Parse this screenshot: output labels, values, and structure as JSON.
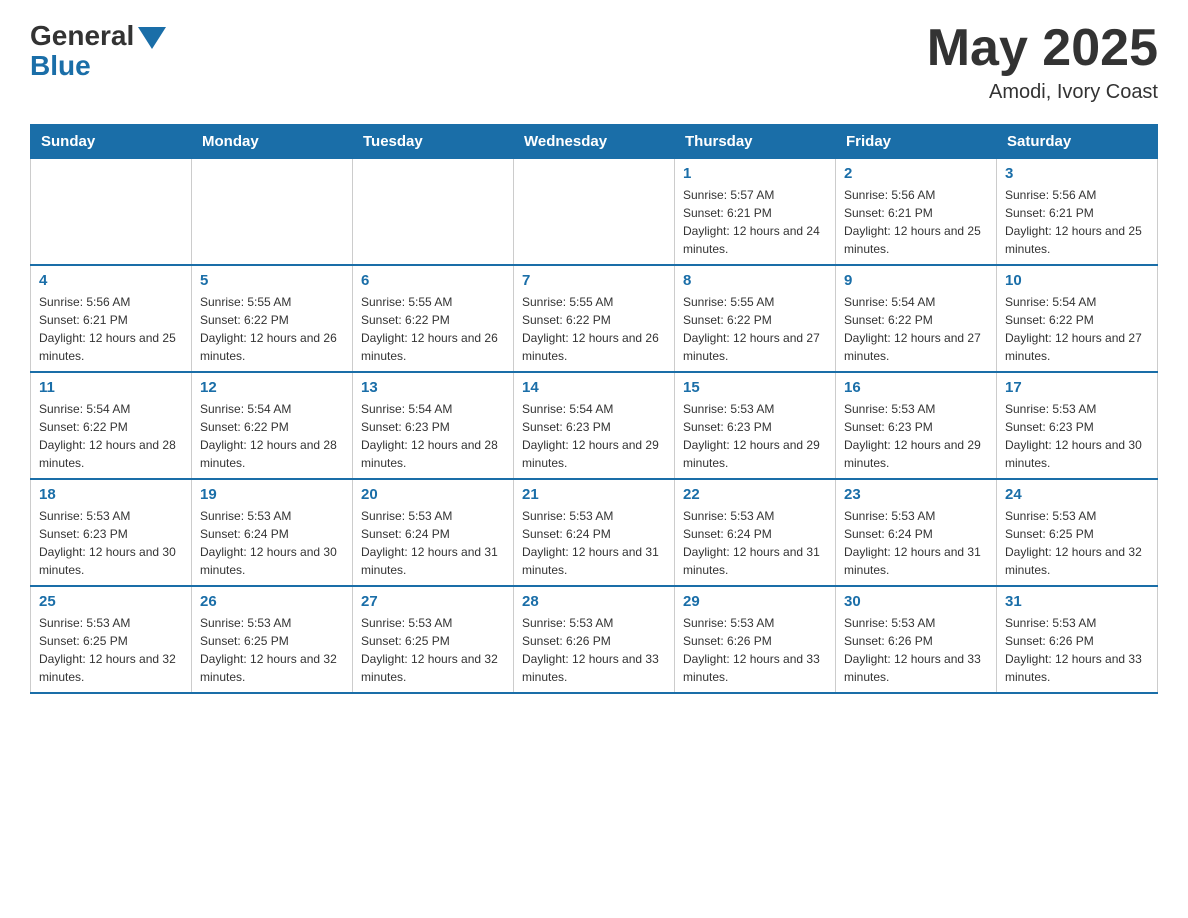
{
  "header": {
    "logo_general": "General",
    "logo_blue": "Blue",
    "title": "May 2025",
    "subtitle": "Amodi, Ivory Coast"
  },
  "weekdays": [
    "Sunday",
    "Monday",
    "Tuesday",
    "Wednesday",
    "Thursday",
    "Friday",
    "Saturday"
  ],
  "weeks": [
    [
      {
        "day": "",
        "info": ""
      },
      {
        "day": "",
        "info": ""
      },
      {
        "day": "",
        "info": ""
      },
      {
        "day": "",
        "info": ""
      },
      {
        "day": "1",
        "info": "Sunrise: 5:57 AM\nSunset: 6:21 PM\nDaylight: 12 hours and 24 minutes."
      },
      {
        "day": "2",
        "info": "Sunrise: 5:56 AM\nSunset: 6:21 PM\nDaylight: 12 hours and 25 minutes."
      },
      {
        "day": "3",
        "info": "Sunrise: 5:56 AM\nSunset: 6:21 PM\nDaylight: 12 hours and 25 minutes."
      }
    ],
    [
      {
        "day": "4",
        "info": "Sunrise: 5:56 AM\nSunset: 6:21 PM\nDaylight: 12 hours and 25 minutes."
      },
      {
        "day": "5",
        "info": "Sunrise: 5:55 AM\nSunset: 6:22 PM\nDaylight: 12 hours and 26 minutes."
      },
      {
        "day": "6",
        "info": "Sunrise: 5:55 AM\nSunset: 6:22 PM\nDaylight: 12 hours and 26 minutes."
      },
      {
        "day": "7",
        "info": "Sunrise: 5:55 AM\nSunset: 6:22 PM\nDaylight: 12 hours and 26 minutes."
      },
      {
        "day": "8",
        "info": "Sunrise: 5:55 AM\nSunset: 6:22 PM\nDaylight: 12 hours and 27 minutes."
      },
      {
        "day": "9",
        "info": "Sunrise: 5:54 AM\nSunset: 6:22 PM\nDaylight: 12 hours and 27 minutes."
      },
      {
        "day": "10",
        "info": "Sunrise: 5:54 AM\nSunset: 6:22 PM\nDaylight: 12 hours and 27 minutes."
      }
    ],
    [
      {
        "day": "11",
        "info": "Sunrise: 5:54 AM\nSunset: 6:22 PM\nDaylight: 12 hours and 28 minutes."
      },
      {
        "day": "12",
        "info": "Sunrise: 5:54 AM\nSunset: 6:22 PM\nDaylight: 12 hours and 28 minutes."
      },
      {
        "day": "13",
        "info": "Sunrise: 5:54 AM\nSunset: 6:23 PM\nDaylight: 12 hours and 28 minutes."
      },
      {
        "day": "14",
        "info": "Sunrise: 5:54 AM\nSunset: 6:23 PM\nDaylight: 12 hours and 29 minutes."
      },
      {
        "day": "15",
        "info": "Sunrise: 5:53 AM\nSunset: 6:23 PM\nDaylight: 12 hours and 29 minutes."
      },
      {
        "day": "16",
        "info": "Sunrise: 5:53 AM\nSunset: 6:23 PM\nDaylight: 12 hours and 29 minutes."
      },
      {
        "day": "17",
        "info": "Sunrise: 5:53 AM\nSunset: 6:23 PM\nDaylight: 12 hours and 30 minutes."
      }
    ],
    [
      {
        "day": "18",
        "info": "Sunrise: 5:53 AM\nSunset: 6:23 PM\nDaylight: 12 hours and 30 minutes."
      },
      {
        "day": "19",
        "info": "Sunrise: 5:53 AM\nSunset: 6:24 PM\nDaylight: 12 hours and 30 minutes."
      },
      {
        "day": "20",
        "info": "Sunrise: 5:53 AM\nSunset: 6:24 PM\nDaylight: 12 hours and 31 minutes."
      },
      {
        "day": "21",
        "info": "Sunrise: 5:53 AM\nSunset: 6:24 PM\nDaylight: 12 hours and 31 minutes."
      },
      {
        "day": "22",
        "info": "Sunrise: 5:53 AM\nSunset: 6:24 PM\nDaylight: 12 hours and 31 minutes."
      },
      {
        "day": "23",
        "info": "Sunrise: 5:53 AM\nSunset: 6:24 PM\nDaylight: 12 hours and 31 minutes."
      },
      {
        "day": "24",
        "info": "Sunrise: 5:53 AM\nSunset: 6:25 PM\nDaylight: 12 hours and 32 minutes."
      }
    ],
    [
      {
        "day": "25",
        "info": "Sunrise: 5:53 AM\nSunset: 6:25 PM\nDaylight: 12 hours and 32 minutes."
      },
      {
        "day": "26",
        "info": "Sunrise: 5:53 AM\nSunset: 6:25 PM\nDaylight: 12 hours and 32 minutes."
      },
      {
        "day": "27",
        "info": "Sunrise: 5:53 AM\nSunset: 6:25 PM\nDaylight: 12 hours and 32 minutes."
      },
      {
        "day": "28",
        "info": "Sunrise: 5:53 AM\nSunset: 6:26 PM\nDaylight: 12 hours and 33 minutes."
      },
      {
        "day": "29",
        "info": "Sunrise: 5:53 AM\nSunset: 6:26 PM\nDaylight: 12 hours and 33 minutes."
      },
      {
        "day": "30",
        "info": "Sunrise: 5:53 AM\nSunset: 6:26 PM\nDaylight: 12 hours and 33 minutes."
      },
      {
        "day": "31",
        "info": "Sunrise: 5:53 AM\nSunset: 6:26 PM\nDaylight: 12 hours and 33 minutes."
      }
    ]
  ]
}
